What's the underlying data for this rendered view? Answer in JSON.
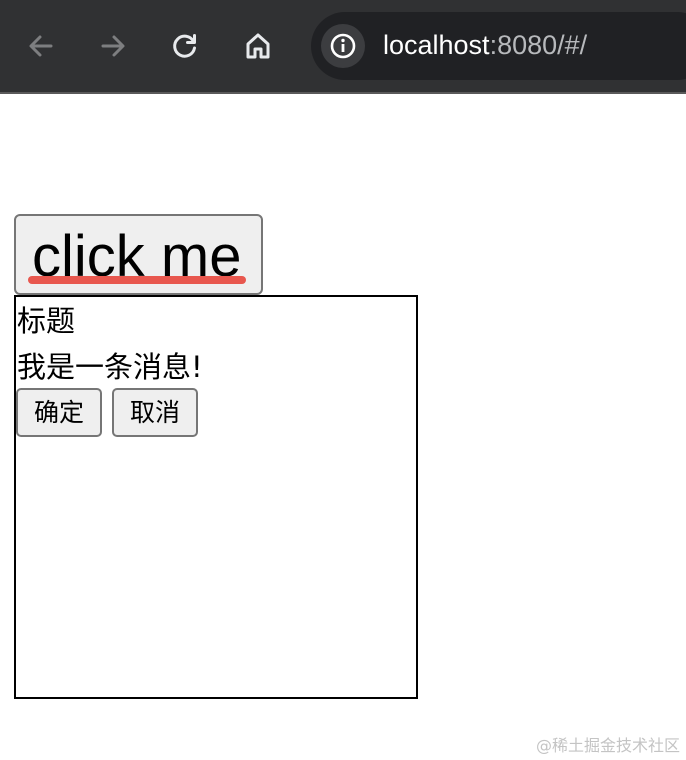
{
  "browser": {
    "url_host": "localhost",
    "url_rest": ":8080/#/",
    "icons": {
      "back": "back-arrow-icon",
      "forward": "forward-arrow-icon",
      "reload": "reload-icon",
      "home": "home-icon",
      "site_info": "info-icon"
    },
    "colors": {
      "toolbar": "#303133",
      "omnibox": "#202124",
      "url_host": "#ffffff",
      "url_rest": "#b7b9bc"
    }
  },
  "page": {
    "click_button_label": "click me",
    "dialog": {
      "title": "标题",
      "message": "我是一条消息!",
      "ok_label": "确定",
      "cancel_label": "取消"
    }
  },
  "watermark": "@稀土掘金技术社区"
}
